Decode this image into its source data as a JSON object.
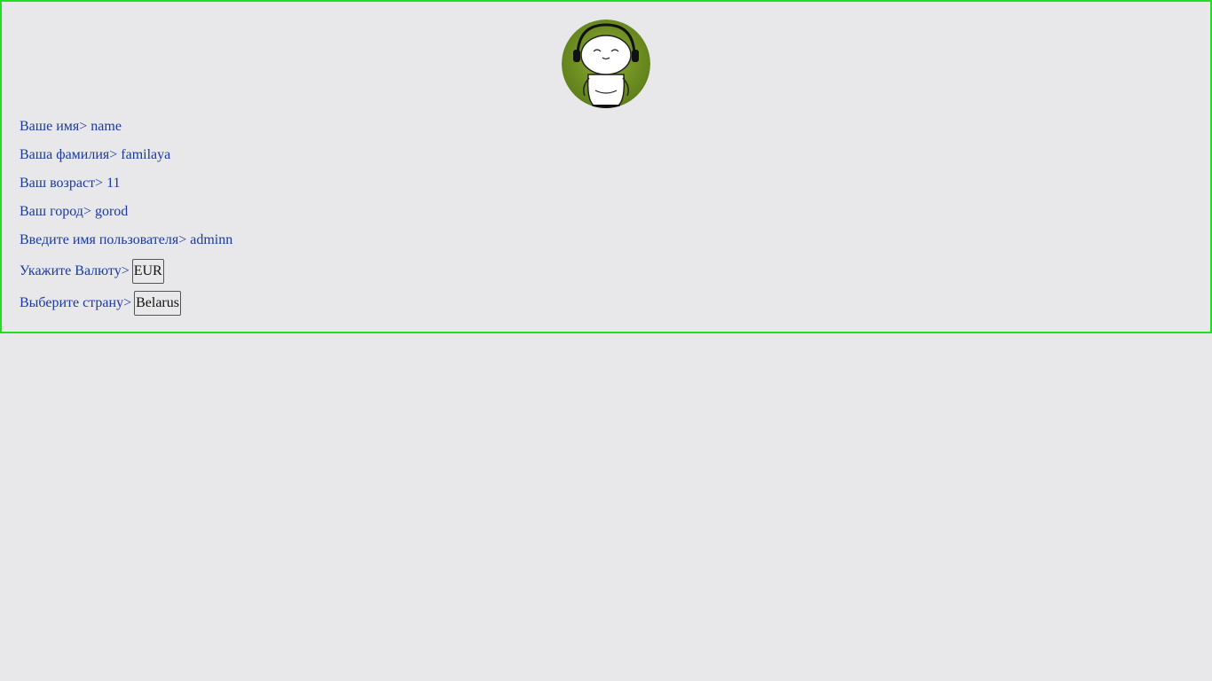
{
  "avatar": {
    "icon": "headphones-character-icon",
    "bg": "#6f8e22"
  },
  "fields": {
    "first_name": {
      "label": "Ваше имя>",
      "value": "name"
    },
    "last_name": {
      "label": "Ваша фамилия>",
      "value": "familaya"
    },
    "age": {
      "label": "Ваш возраст>",
      "value": "11"
    },
    "city": {
      "label": "Ваш город>",
      "value": "gorod"
    },
    "username": {
      "label": "Введите имя пользователя>",
      "value": "adminn"
    },
    "currency": {
      "label": "Укажите Валюту>",
      "selected": "EUR"
    },
    "country": {
      "label": "Выберите страну>",
      "selected": "Belarus"
    }
  },
  "colors": {
    "text": "#1a3a9c",
    "border": "#22dd22",
    "background": "#e8e8ea"
  }
}
